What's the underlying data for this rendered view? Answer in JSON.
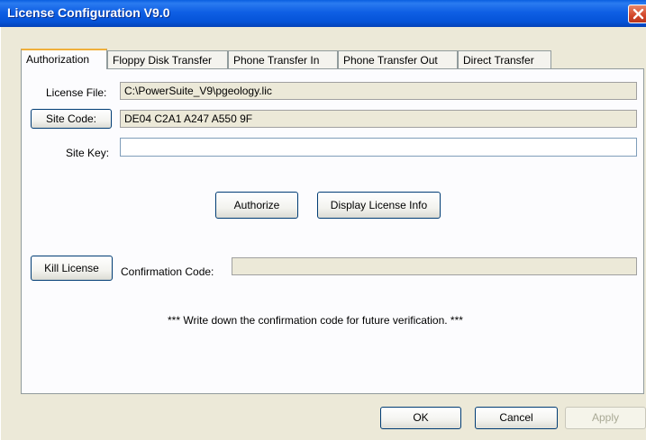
{
  "window": {
    "title": "License Configuration V9.0"
  },
  "tabs": [
    {
      "label": "Authorization",
      "active": true
    },
    {
      "label": "Floppy Disk Transfer"
    },
    {
      "label": "Phone Transfer In"
    },
    {
      "label": "Phone Transfer Out"
    },
    {
      "label": "Direct Transfer"
    }
  ],
  "authorization": {
    "license_file_label": "License File:",
    "license_file_value": "C:\\PowerSuite_V9\\pgeology.lic",
    "site_code_button": "Site Code:",
    "site_code_value": "DE04 C2A1 A247 A550 9F",
    "site_key_label": "Site Key:",
    "site_key_value": "",
    "authorize_button": "Authorize",
    "display_license_button": "Display License Info",
    "kill_license_button": "Kill License",
    "confirmation_label": "Confirmation Code:",
    "confirmation_value": "",
    "note": "*** Write down the confirmation code for future verification. ***"
  },
  "footer": {
    "ok": "OK",
    "cancel": "Cancel",
    "apply": "Apply"
  },
  "colors": {
    "titlebar": "#0553d8",
    "face": "#ece9d8",
    "active_tab_accent": "#f0b03a"
  }
}
